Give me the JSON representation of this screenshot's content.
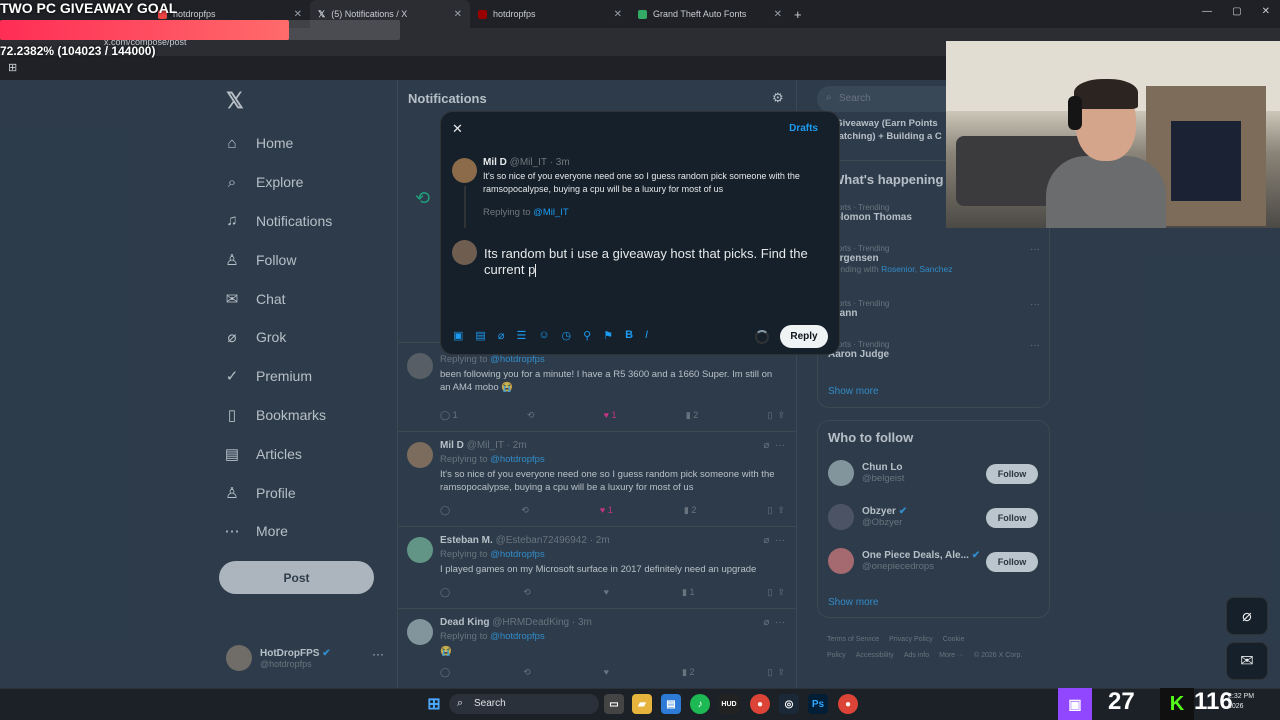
{
  "browser": {
    "tabs": [
      {
        "label": "hotdropfps",
        "active": false
      },
      {
        "label": "(5) Notifications / X",
        "active": true
      },
      {
        "label": "hotdropfps",
        "active": false
      },
      {
        "label": "Grand Theft Auto Fonts",
        "active": false
      }
    ],
    "url": "x.com/compose/post"
  },
  "overlay": {
    "goal_title": "TWO PC GIVEAWAY GOAL",
    "goal_progress_text": "72.2382% (104023 / 144000)",
    "goal_fraction": 0.722382
  },
  "sidebar": {
    "items": [
      {
        "icon": "home-icon",
        "glyph": "⌂",
        "label": "Home"
      },
      {
        "icon": "search-icon",
        "glyph": "⌕",
        "label": "Explore"
      },
      {
        "icon": "bell-icon",
        "glyph": "♫",
        "label": "Notifications"
      },
      {
        "icon": "follow-icon",
        "glyph": "♙",
        "label": "Follow"
      },
      {
        "icon": "chat-icon",
        "glyph": "✉",
        "label": "Chat"
      },
      {
        "icon": "grok-icon",
        "glyph": "⌀",
        "label": "Grok"
      },
      {
        "icon": "premium-icon",
        "glyph": "✓",
        "label": "Premium"
      },
      {
        "icon": "bookmark-icon",
        "glyph": "▯",
        "label": "Bookmarks"
      },
      {
        "icon": "articles-icon",
        "glyph": "▤",
        "label": "Articles"
      },
      {
        "icon": "profile-icon",
        "glyph": "♙",
        "label": "Profile"
      },
      {
        "icon": "more-icon",
        "glyph": "⋯",
        "label": "More"
      }
    ],
    "post_label": "Post",
    "account": {
      "name": "HotDropFPS",
      "handle": "@hotdropfps"
    }
  },
  "main": {
    "title": "Notifications",
    "posts": [
      {
        "name": "",
        "handle": "",
        "replying": "@hotdropfps",
        "text": "been following you for a minute! I have a R5 3600 and a 1660 Super. Im still on an AM4 mobo 😭",
        "replies": "1",
        "likes": "1",
        "views": "2"
      },
      {
        "name": "Mil D",
        "handle": "@Mil_IT · 2m",
        "replying": "@hotdropfps",
        "text": "It's so nice of you everyone need one so I guess random pick someone with the ramsopocalypse, buying a cpu will be a luxury for most of us",
        "replies": "",
        "likes": "1",
        "views": "2"
      },
      {
        "name": "Esteban M.",
        "handle": "@Esteban72496942 · 2m",
        "replying": "@hotdropfps",
        "text": "I played games on my Microsoft surface in 2017 definitely need an upgrade",
        "replies": "",
        "likes": "",
        "views": "1"
      },
      {
        "name": "Dead King",
        "handle": "@HRMDeadKing · 3m",
        "replying": "@hotdropfps",
        "text": "😭",
        "replies": "",
        "likes": "",
        "views": "2"
      }
    ],
    "replying_label": "Replying to"
  },
  "right": {
    "search_placeholder": "Search",
    "live_banner": ".iGiveaway (Earn Points Watching) + Building a C",
    "happening_title": "What's happening",
    "trends": [
      {
        "meta": "Sports · Trending",
        "title": "Solomon Thomas",
        "with": ""
      },
      {
        "meta": "Sports · Trending",
        "title": "Jorgensen",
        "with": "Rosenior, Sanchez"
      },
      {
        "meta": "Sports · Trending",
        "title": "Grann",
        "with": ""
      },
      {
        "meta": "Sports · Trending",
        "title": "Aaron Judge",
        "with": ""
      }
    ],
    "trending_with": "Trending with",
    "show_more": "Show more",
    "who_title": "Who to follow",
    "who": [
      {
        "name": "Chun Lo",
        "handle": "@belgeist",
        "verified": false
      },
      {
        "name": "Obzyer",
        "handle": "@Obzyer",
        "verified": true
      },
      {
        "name": "One Piece Deals, Ale...",
        "handle": "@onepiecedrops",
        "verified": true
      }
    ],
    "follow_label": "Follow",
    "footer": [
      "Terms of Service",
      "Privacy Policy",
      "Cookie Policy",
      "Accessibility",
      "Ads info",
      "More ···",
      "© 2026 X Corp."
    ]
  },
  "modal": {
    "drafts_label": "Drafts",
    "quoted": {
      "name": "Mil D",
      "handle": "@Mil_IT · 3m",
      "text": "It's so nice of you everyone need one so I guess random pick someone with the ramsopocalypse, buying a cpu will be a luxury for most of us",
      "replying_to": "@Mil_IT"
    },
    "draft_text": "Its random but i use a giveaway host that picks. Find the current p",
    "reply_label": "Reply"
  },
  "taskbar": {
    "search_label": "Search",
    "twitch_count": "27",
    "kick_count": "116",
    "clock_time": "2:32 PM",
    "clock_date": "2026"
  },
  "colors": {
    "accent": "#1d9bf0",
    "like": "#f91880",
    "retweet": "#00ba7c",
    "bg": "#15202b",
    "twitch": "#9146ff",
    "kick": "#53fc18"
  }
}
